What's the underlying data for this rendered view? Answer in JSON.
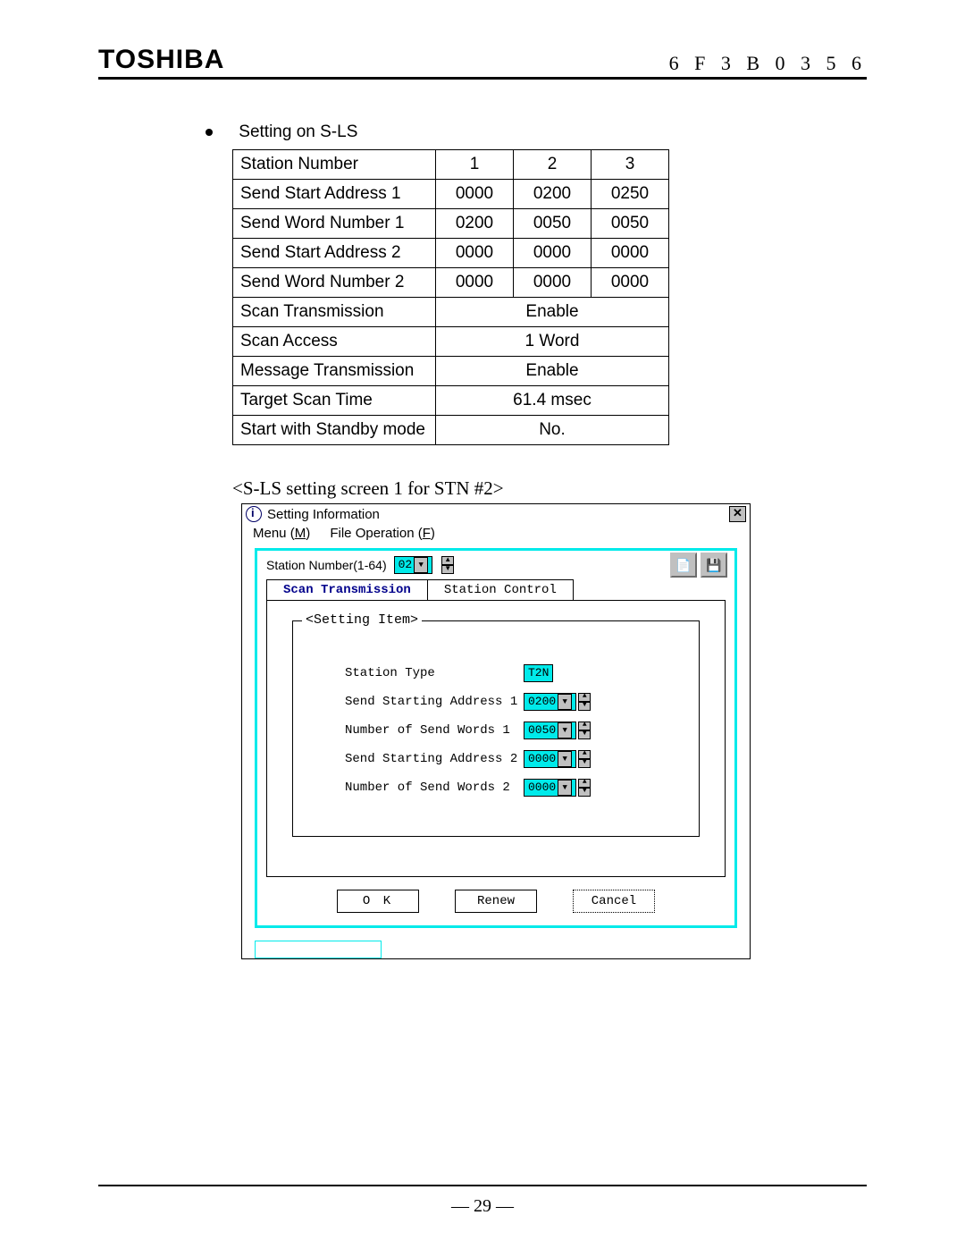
{
  "header": {
    "brand": "TOSHIBA",
    "doc_code": "6 F 3 B 0 3 5 6"
  },
  "bullet_text": "Setting on S-LS",
  "table": {
    "row_labels": {
      "station_number": "Station Number",
      "ssa1": "Send Start Address 1",
      "swn1": "Send Word Number 1",
      "ssa2": "Send Start Address 2",
      "swn2": "Send Word Number 2",
      "scan_tx": "Scan Transmission",
      "scan_access": "Scan Access",
      "msg_tx": "Message Transmission",
      "tgt_scan": "Target Scan Time",
      "standby": "Start with Standby mode"
    },
    "cols": {
      "c1": "1",
      "c2": "2",
      "c3": "3"
    },
    "ssa1": {
      "c1": "0000",
      "c2": "0200",
      "c3": "0250"
    },
    "swn1": {
      "c1": "0200",
      "c2": "0050",
      "c3": "0050"
    },
    "ssa2": {
      "c1": "0000",
      "c2": "0000",
      "c3": "0000"
    },
    "swn2": {
      "c1": "0000",
      "c2": "0000",
      "c3": "0000"
    },
    "scan_tx": "Enable",
    "scan_access": "1 Word",
    "msg_tx": "Enable",
    "tgt_scan": "61.4 msec",
    "standby": "No."
  },
  "caption": "<S-LS setting screen 1 for STN #2>",
  "dialog": {
    "title": "Setting Information",
    "close_glyph": "✕",
    "menu": {
      "m1a": "Menu (",
      "m1u": "M",
      "m1b": ")",
      "m2a": "File Operation (",
      "m2u": "F",
      "m2b": ")"
    },
    "stn_label": "Station Number(1-64)",
    "stn_value": "02",
    "tabs": {
      "t1": "Scan Transmission",
      "t2": "Station Control"
    },
    "legend": "<Setting Item>",
    "rows": {
      "r1": {
        "label": "Station Type",
        "value": "T2N",
        "kind": "plain"
      },
      "r2": {
        "label": "Send Starting Address 1",
        "value": "0200",
        "kind": "spin"
      },
      "r3": {
        "label": "Number of Send Words 1",
        "value": "0050",
        "kind": "spin"
      },
      "r4": {
        "label": "Send Starting Address 2",
        "value": "0000",
        "kind": "spin"
      },
      "r5": {
        "label": "Number of Send Words 2",
        "value": "0000",
        "kind": "spin"
      }
    },
    "buttons": {
      "ok": "O K",
      "renew": "Renew",
      "cancel": "Cancel"
    },
    "toolbar": {
      "b1": "📄",
      "b2": "💾"
    }
  },
  "page_number": "— 29 —"
}
